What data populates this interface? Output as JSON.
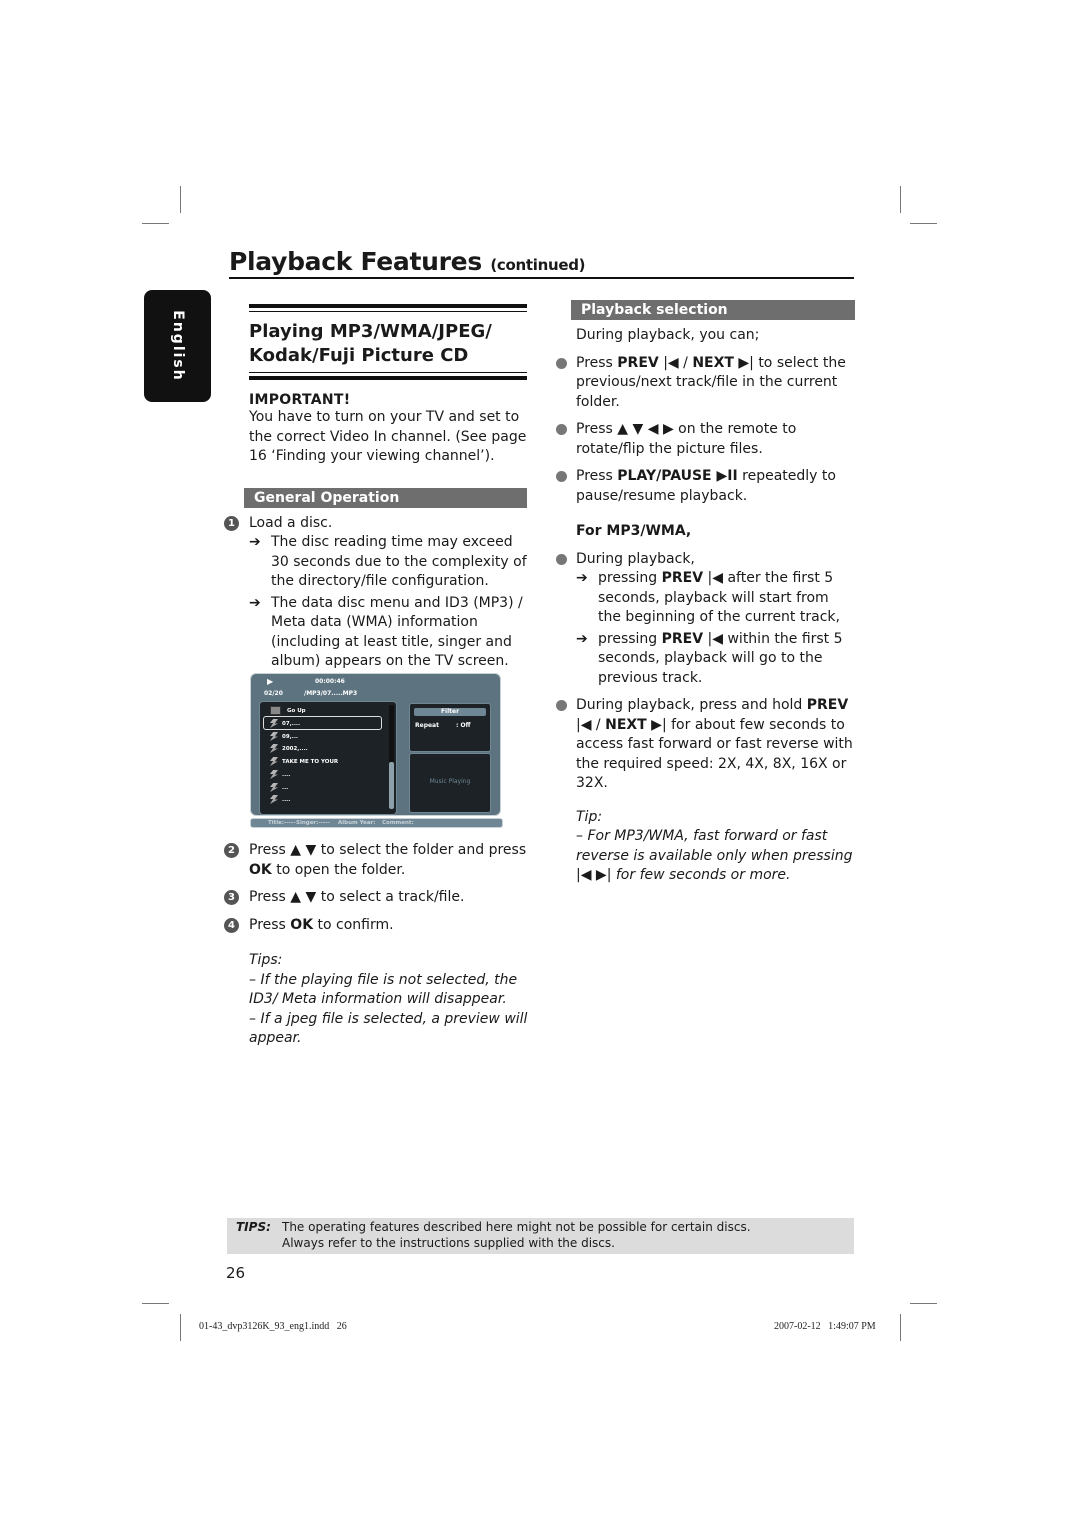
{
  "header": {
    "title": "Playback Features",
    "title_suffix": "(continued)"
  },
  "side_tab": {
    "label": "English"
  },
  "left_column": {
    "section_title_line1": "Playing MP3/WMA/JPEG/",
    "section_title_line2": "Kodak/Fuji Picture CD",
    "important_label": "IMPORTANT!",
    "important_text": "You have to turn on your TV and set to the correct Video In channel.  (See page 16 ‘Finding your viewing channel’).",
    "general_operation_bar": "General Operation",
    "steps": [
      {
        "number": "1",
        "text": "Load a disc.",
        "notes": [
          "The disc reading time may exceed 30 seconds due to the complexity of the directory/file configuration.",
          "The data disc menu and ID3 (MP3) / Meta data (WMA) information (including at least title, singer and album) appears on the TV screen."
        ]
      },
      {
        "number": "2",
        "pre": "Press ▲ ▼ to select the folder and press ",
        "bold": "OK",
        "post": " to open the folder."
      },
      {
        "number": "3",
        "text": "Press ▲ ▼ to select a track/file."
      },
      {
        "number": "4",
        "pre": "Press ",
        "bold": "OK",
        "post": " to confirm."
      }
    ],
    "tips_label": "Tips:",
    "tips": [
      "– If the playing file is not selected, the ID3/ Meta information will disappear.",
      "– If a jpeg file is selected, a preview will appear."
    ]
  },
  "tv_screen": {
    "play_icon": "▶",
    "time": "00:00:46",
    "track_counter": "02/20",
    "path": "/MP3/07.....MP3",
    "list_items": [
      "Go Up",
      "07,....",
      "09,...",
      "2002,....",
      "TAKE ME TO YOUR",
      "....",
      "...",
      "...."
    ],
    "selected_index": 1,
    "filter_header": "Filter",
    "repeat_label": "Repeat",
    "repeat_value": ": Off",
    "music_status": "Music Playing",
    "status_fields": [
      "Title:-----",
      "Singer:-----",
      "Album Year:",
      "Comment:"
    ]
  },
  "right_column": {
    "bar": "Playback selection",
    "intro": "During playback, you can;",
    "bullets": [
      {
        "pre": "Press ",
        "b1": "PREV",
        "mid1": " |◀ / ",
        "b2": "NEXT",
        "post": " ▶| to select the previous/next track/file in the current folder."
      },
      {
        "text": "Press ▲ ▼ ◀ ▶ on the remote to rotate/flip the picture files."
      },
      {
        "pre": "Press ",
        "b1": "PLAY/PAUSE ▶II",
        "post": " repeatedly to pause/resume playback."
      }
    ],
    "mp3_heading": "For MP3/WMA,",
    "mp3_bullet": "During playback,",
    "mp3_notes": [
      {
        "pre": "pressing ",
        "bold": "PREV",
        "post": " |◀ after the first 5 seconds, playback will start from the beginning of the current track,"
      },
      {
        "pre": "pressing ",
        "bold": "PREV",
        "post": " |◀ within the first 5 seconds, playback will go to the previous track."
      }
    ],
    "hold_bullet": {
      "pre": "During playback, press and hold ",
      "b1": "PREV",
      "mid": " |◀ / ",
      "b2": "NEXT",
      "post": " ▶| for about few seconds to access fast forward or fast reverse with the required speed: 2X, 4X, 8X, 16X or 32X."
    },
    "tip_label": "Tip:",
    "tip_text": "– For MP3/WMA, fast forward or fast reverse is available only when pressing |◀ ▶| for few seconds or more."
  },
  "footer": {
    "tips_label": "TIPS:",
    "tips_line1": "The operating features described here might not be possible for certain discs.",
    "tips_line2": "Always refer to the instructions supplied with the discs.",
    "page_number": "26",
    "slug_file": "01-43_dvp3126K_93_eng1.indd   26",
    "slug_date": "2007-02-12   1:49:07 PM"
  }
}
